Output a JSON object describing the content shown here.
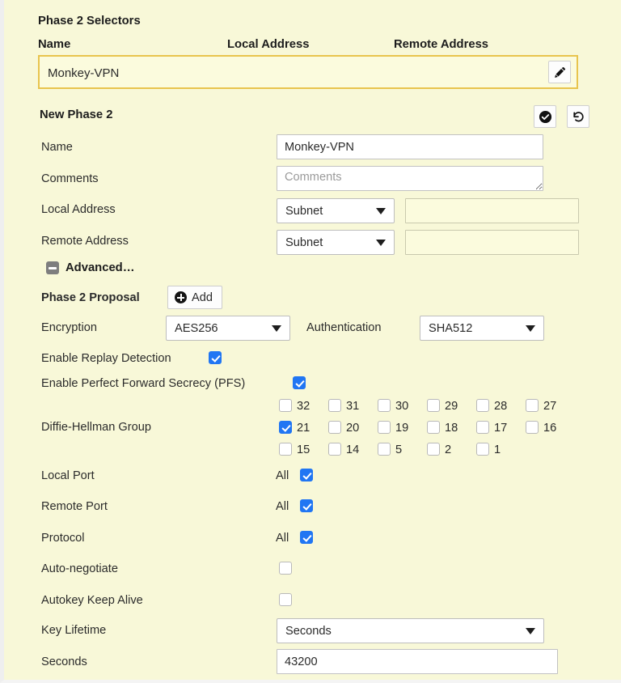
{
  "colors": {
    "page_background": "#f8f8d8",
    "selector_row_border": "#e8c44d",
    "checkbox_checked": "#2176f3",
    "text": "#2b2b2b"
  },
  "selectors_panel": {
    "title": "Phase 2 Selectors",
    "columns": [
      "Name",
      "Local Address",
      "Remote Address"
    ],
    "rows": [
      {
        "name": "Monkey-VPN",
        "local_address": "",
        "remote_address": "",
        "edit_icon": "pencil-icon"
      }
    ]
  },
  "new_phase2": {
    "title": "New Phase 2",
    "actions": [
      {
        "icon": "check-circle-icon",
        "name": "save"
      },
      {
        "icon": "undo-rotate-icon",
        "name": "reset"
      }
    ],
    "fields": {
      "name_label": "Name",
      "name_value": "Monkey-VPN",
      "comments_label": "Comments",
      "comments_value": "",
      "comments_placeholder": "Comments",
      "local_address_label": "Local Address",
      "local_address_type": "Subnet",
      "local_address_value": "",
      "remote_address_label": "Remote Address",
      "remote_address_type": "Subnet",
      "remote_address_value": ""
    },
    "advanced": {
      "label": "Advanced…",
      "toggle_icon": "minus-square-icon",
      "expanded": true
    },
    "proposal": {
      "label": "Phase 2 Proposal",
      "add_label": "Add",
      "add_icon": "plus-circle-icon",
      "encryption_label": "Encryption",
      "encryption_value": "AES256",
      "authentication_label": "Authentication",
      "authentication_value": "SHA512"
    },
    "options": {
      "replay_detection_label": "Enable Replay Detection",
      "replay_detection_checked": true,
      "pfs_label": "Enable Perfect Forward Secrecy (PFS)",
      "pfs_checked": true,
      "dh_label": "Diffie-Hellman Group",
      "dh_rows": [
        [
          {
            "label": "32",
            "checked": false
          },
          {
            "label": "31",
            "checked": false
          },
          {
            "label": "30",
            "checked": false
          },
          {
            "label": "29",
            "checked": false
          },
          {
            "label": "28",
            "checked": false
          },
          {
            "label": "27",
            "checked": false
          }
        ],
        [
          {
            "label": "21",
            "checked": true
          },
          {
            "label": "20",
            "checked": false
          },
          {
            "label": "19",
            "checked": false
          },
          {
            "label": "18",
            "checked": false
          },
          {
            "label": "17",
            "checked": false
          },
          {
            "label": "16",
            "checked": false
          }
        ],
        [
          {
            "label": "15",
            "checked": false
          },
          {
            "label": "14",
            "checked": false
          },
          {
            "label": "5",
            "checked": false
          },
          {
            "label": "2",
            "checked": false
          },
          {
            "label": "1",
            "checked": false
          }
        ]
      ],
      "local_port_label": "Local Port",
      "local_port_all_text": "All",
      "local_port_checked": true,
      "remote_port_label": "Remote Port",
      "remote_port_all_text": "All",
      "remote_port_checked": true,
      "protocol_label": "Protocol",
      "protocol_all_text": "All",
      "protocol_checked": true,
      "auto_negotiate_label": "Auto-negotiate",
      "auto_negotiate_checked": false,
      "autokey_keep_alive_label": "Autokey Keep Alive",
      "autokey_keep_alive_checked": false,
      "key_lifetime_label": "Key Lifetime",
      "key_lifetime_value": "Seconds",
      "seconds_label": "Seconds",
      "seconds_value": "43200"
    }
  }
}
